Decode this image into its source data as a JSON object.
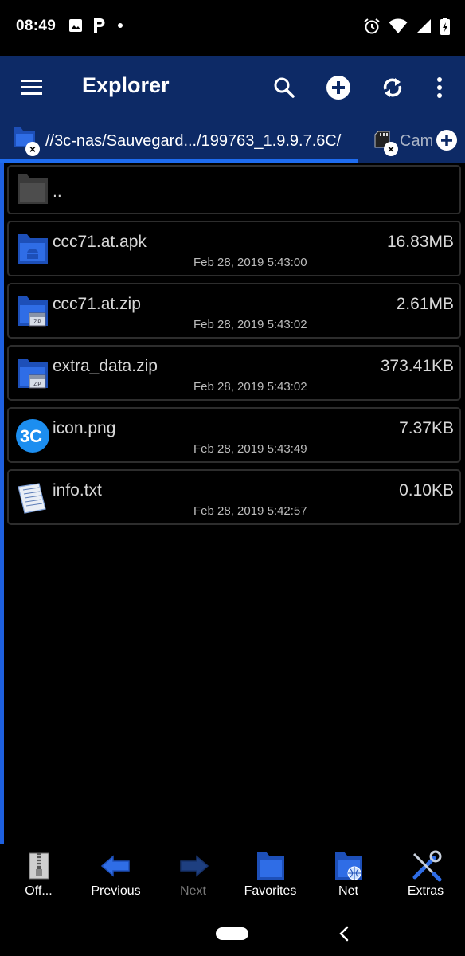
{
  "status_bar": {
    "time": "08:49",
    "left_icons": [
      "image-icon",
      "p-app-icon",
      "dot-icon"
    ],
    "right_icons": [
      "alarm-icon",
      "wifi-icon",
      "signal-icon",
      "battery-icon"
    ]
  },
  "toolbar": {
    "title": "Explorer",
    "background": "#0d2a66",
    "buttons": [
      "menu-icon",
      "search-icon",
      "add-circle-icon",
      "sync-icon",
      "more-vert-icon"
    ]
  },
  "tabs": {
    "active_path": "//3c-nas/Sauvegard.../199763_1.9.9.7.6C/",
    "second_label": "Cam",
    "accent": "#1e6cf0"
  },
  "files": [
    {
      "name": "..",
      "size": "",
      "date": "",
      "icon": "folder-gray-icon"
    },
    {
      "name": "ccc71.at.apk",
      "size": "16.83MB",
      "date": "Feb 28, 2019 5:43:00",
      "icon": "folder-android-icon"
    },
    {
      "name": "ccc71.at.zip",
      "size": "2.61MB",
      "date": "Feb 28, 2019 5:43:02",
      "icon": "folder-zip-icon"
    },
    {
      "name": "extra_data.zip",
      "size": "373.41KB",
      "date": "Feb 28, 2019 5:43:02",
      "icon": "folder-zip-icon"
    },
    {
      "name": "icon.png",
      "size": "7.37KB",
      "date": "Feb 28, 2019 5:43:49",
      "icon": "3c-logo-icon"
    },
    {
      "name": "info.txt",
      "size": "0.10KB",
      "date": "Feb 28, 2019 5:42:57",
      "icon": "text-file-icon"
    }
  ],
  "bottom_nav": [
    {
      "label": "Off...",
      "icon": "zipper-icon",
      "enabled": true
    },
    {
      "label": "Previous",
      "icon": "arrow-left-icon",
      "enabled": true
    },
    {
      "label": "Next",
      "icon": "arrow-right-icon",
      "enabled": false
    },
    {
      "label": "Favorites",
      "icon": "folder-blue-icon",
      "enabled": true
    },
    {
      "label": "Net",
      "icon": "folder-globe-icon",
      "enabled": true
    },
    {
      "label": "Extras",
      "icon": "tools-icon",
      "enabled": true
    }
  ]
}
